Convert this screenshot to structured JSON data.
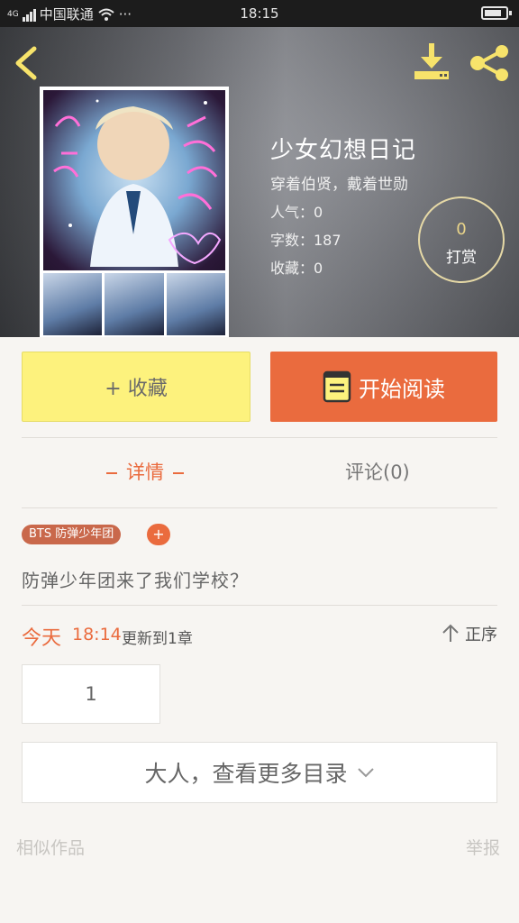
{
  "status_bar": {
    "carrier": "中国联通",
    "network": "4G",
    "dots": "···",
    "time": "18:15"
  },
  "header": {
    "back_icon": "chevron-left-icon",
    "download_icon": "download-icon",
    "share_icon": "share-icon",
    "icon_color": "#f7e36b"
  },
  "book": {
    "title": "少女幻想日记",
    "author": "穿着伯贤，戴着世勋",
    "popularity": "人气：0",
    "word_count": "字数：187",
    "favorites": "收藏：0",
    "tip": {
      "count": "0",
      "label": "打赏"
    }
  },
  "actions": {
    "favorite_label": "+ 收藏",
    "read_label": "开始阅读"
  },
  "tabs": {
    "detail": "详情",
    "comments": "评论(0)"
  },
  "tags": {
    "primary": "BTS  防弹少年团",
    "add": "+"
  },
  "description": "防弹少年团来了我们学校？",
  "update": {
    "day": "今天",
    "time": "18:14",
    "text": "更新到1章",
    "sort_label": "正序"
  },
  "chapters": [
    "1"
  ],
  "more_catalog": "大人，查看更多目录",
  "footer": {
    "similar": "相似作品",
    "report": "举报"
  },
  "colors": {
    "accent": "#ea6b3e",
    "favorite_bg": "#fdf27d",
    "background": "#f7f5f2"
  }
}
